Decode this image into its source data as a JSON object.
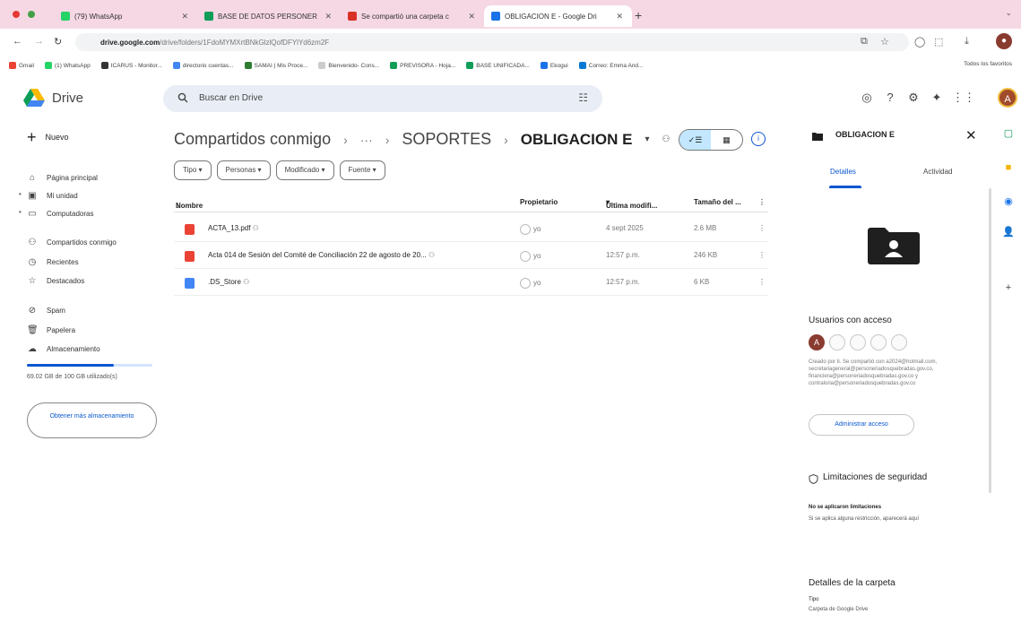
{
  "browser": {
    "tabs": [
      {
        "label": "(79) WhatsApp",
        "color": "#25d366"
      },
      {
        "label": "BASE DE DATOS PERSONER",
        "color": "#0f9d58"
      },
      {
        "label": "Se compartió una carpeta c",
        "color": "#d93025"
      },
      {
        "label": "OBLIGACION E - Google Dri",
        "color": "#1a73e8"
      }
    ],
    "url_host": "drive.google.com",
    "url_path": "/drive/folders/1FdoMYMXrtBNkGlzlQofDFYlYd6zm2F",
    "bookmarks": [
      "Gmail",
      "(1) WhatsApp",
      "ICARUS - Monitor...",
      "directorio cuentas...",
      "SAMAI | Mis Proce...",
      "Bienvenido- Cons...",
      "PREVISORA - Hoja...",
      "BASE UNIFICADA...",
      "Ekogui",
      "Correo: Emma And..."
    ],
    "bookmarks_all": "Todos los favoritos"
  },
  "drive": {
    "app_name": "Drive",
    "search_placeholder": "Buscar en Drive",
    "avatar_letter": "A"
  },
  "sidebar": {
    "new_label": "Nuevo",
    "items": [
      {
        "label": "Página principal",
        "icon": "home-icon"
      },
      {
        "label": "Mi unidad",
        "icon": "my-drive-icon"
      },
      {
        "label": "Computadoras",
        "icon": "computer-icon"
      },
      {
        "label": "Compartidos conmigo",
        "icon": "shared-icon"
      },
      {
        "label": "Recientes",
        "icon": "clock-icon"
      },
      {
        "label": "Destacados",
        "icon": "star-icon"
      },
      {
        "label": "Spam",
        "icon": "spam-icon"
      },
      {
        "label": "Papelera",
        "icon": "trash-icon"
      },
      {
        "label": "Almacenamiento",
        "icon": "cloud-icon"
      }
    ],
    "storage_text": "69.02 GB de 100 GB utilizado(s)",
    "storage_fraction": 0.69,
    "more_storage": "Obtener más almacenamiento"
  },
  "main": {
    "breadcrumb": [
      "Compartidos conmigo",
      "···",
      "SOPORTES",
      "OBLIGACION E"
    ],
    "filters": [
      "Tipo",
      "Personas",
      "Modificado",
      "Fuente"
    ],
    "columns": [
      "Nombre",
      "Propietario",
      "Última modifi...",
      "Tamaño del ..."
    ],
    "files": [
      {
        "name": "ACTA_13.pdf",
        "owner": "yo",
        "modified": "4 sept 2025",
        "size": "2.6 MB",
        "type": "pdf"
      },
      {
        "name": "Acta 014 de Sesión del Comité de Conciliación 22 de agosto de 20...",
        "owner": "yo",
        "modified": "12:57 p.m.",
        "size": "246 KB",
        "type": "pdf"
      },
      {
        "name": ".DS_Store",
        "owner": "yo",
        "modified": "12:57 p.m.",
        "size": "6 KB",
        "type": "doc"
      }
    ]
  },
  "panel": {
    "title": "OBLIGACION E",
    "tab_details": "Detalles",
    "tab_activity": "Actividad",
    "users_title": "Usuarios con acceso",
    "shared_text": "Creado por ti. Se compartió con a2024@hotmail.com, secretariageneral@personeriadosquebradas.gov.co, financiera@personeriadosquebradas.gov.co y contraloria@personeriadosquebradas.gov.co",
    "manage_access": "Administrar acceso",
    "security_title": "Limitaciones de seguridad",
    "security_bold": "No se aplicaron limitaciones",
    "security_text": "Si se aplica alguna restricción, aparecerá aquí",
    "folder_details_title": "Detalles de la carpeta",
    "type_label": "Tipo",
    "type_value": "Carpeta de Google Drive"
  },
  "colors": {
    "accent": "#0b57d0",
    "pdf_red": "#ea4335",
    "doc_blue": "#4285f4",
    "active_toggle": "#c2e7ff"
  }
}
